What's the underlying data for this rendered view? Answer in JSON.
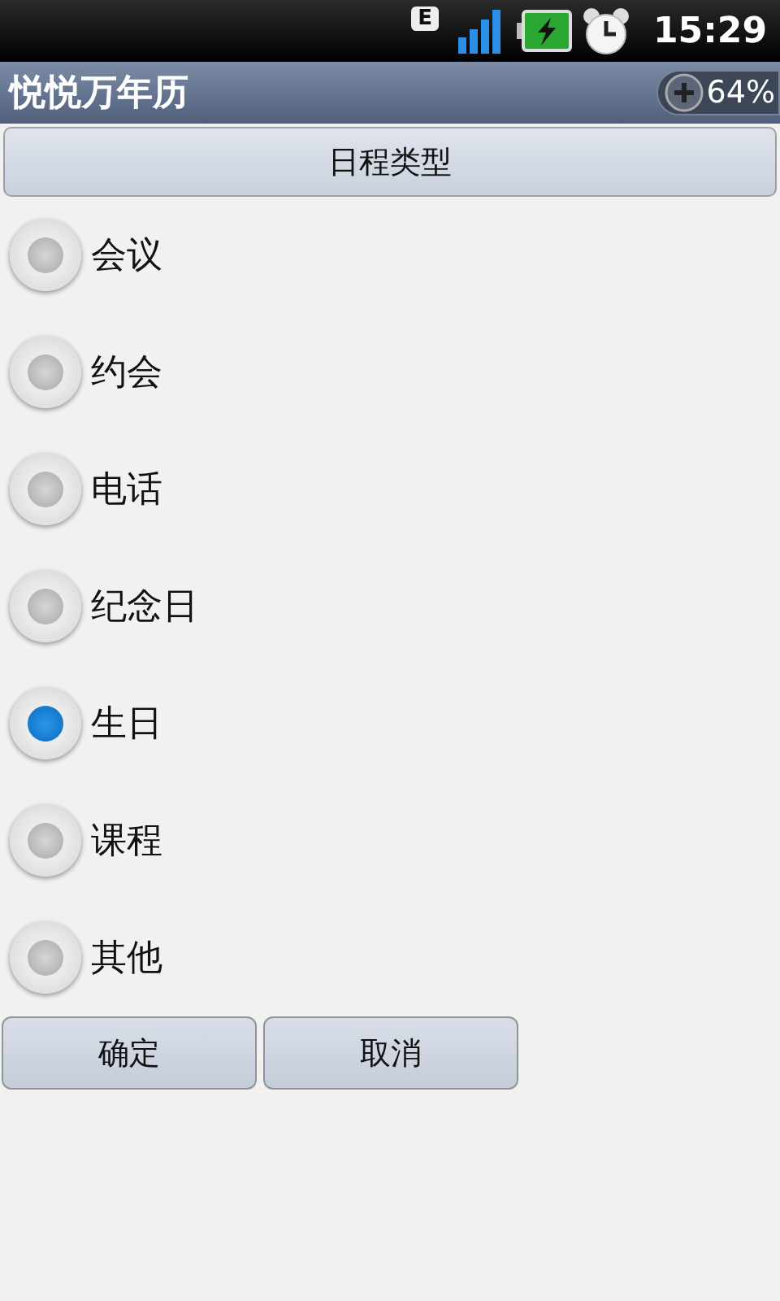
{
  "status_bar": {
    "network": "E",
    "time": "15:29"
  },
  "title_bar": {
    "title": "悦悦万年历",
    "badge": "64%"
  },
  "header": {
    "label": "日程类型"
  },
  "options": [
    {
      "label": "会议",
      "selected": false
    },
    {
      "label": "约会",
      "selected": false
    },
    {
      "label": "电话",
      "selected": false
    },
    {
      "label": "纪念日",
      "selected": false
    },
    {
      "label": "生日",
      "selected": true
    },
    {
      "label": "课程",
      "selected": false
    },
    {
      "label": "其他",
      "selected": false
    }
  ],
  "buttons": [
    "确定",
    "取消"
  ]
}
